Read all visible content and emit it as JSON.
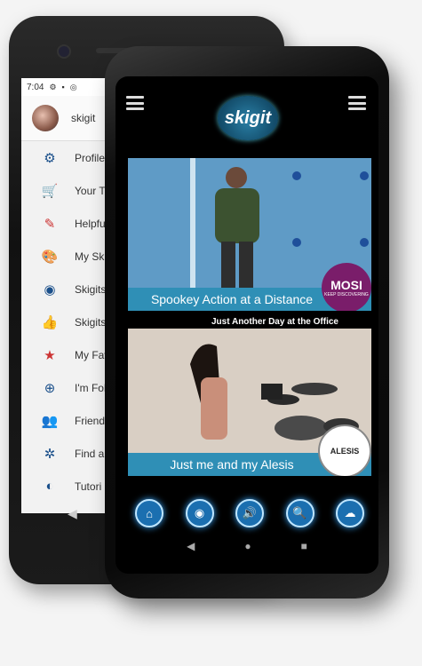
{
  "back_phone": {
    "status": {
      "time": "7:04"
    },
    "profile": {
      "name": "skigit"
    },
    "menu": [
      {
        "label": "Profile",
        "icon": "gear-icon",
        "glyph": "⚙",
        "color": "#1a4f8a"
      },
      {
        "label": "Your Tl",
        "icon": "cart-icon",
        "glyph": "🛒",
        "color": "#c33"
      },
      {
        "label": "Helpfu",
        "icon": "help-icon",
        "glyph": "✎",
        "color": "#c33"
      },
      {
        "label": "My Ski",
        "icon": "palette-icon",
        "glyph": "🎨",
        "color": "#1a4f8a"
      },
      {
        "label": "Skigits",
        "icon": "skigit-icon",
        "glyph": "◉",
        "color": "#1a4f8a"
      },
      {
        "label": "Skigits",
        "icon": "thumbs-up-icon",
        "glyph": "👍",
        "color": "#c33"
      },
      {
        "label": "My Fav",
        "icon": "star-icon",
        "glyph": "★",
        "color": "#c33"
      },
      {
        "label": "I'm Fol",
        "icon": "follow-icon",
        "glyph": "⊕",
        "color": "#1a4f8a"
      },
      {
        "label": "Friends",
        "icon": "friends-icon",
        "glyph": "👥",
        "color": "#1a4f8a"
      },
      {
        "label": "Find a",
        "icon": "bug-icon",
        "glyph": "✲",
        "color": "#1a4f8a"
      },
      {
        "label": "Tutori",
        "icon": "tutorial-icon",
        "glyph": "◐",
        "color": "#1a4f8a"
      }
    ]
  },
  "front_phone": {
    "logo": {
      "text": "skigit"
    },
    "videos": [
      {
        "caption": "Spookey Action at a Distance",
        "badge": "MOSI",
        "badge_sub": "KEEP DISCOVERING"
      },
      {
        "caption": "Just me and my Alesis",
        "badge": "ALESIS"
      }
    ],
    "overlay_title": "Just Another Day at the Office",
    "bottom_buttons": [
      {
        "icon": "home-icon",
        "glyph": "⌂"
      },
      {
        "icon": "globe-icon",
        "glyph": "◉"
      },
      {
        "icon": "speaker-icon",
        "glyph": "🔊"
      },
      {
        "icon": "search-icon",
        "glyph": "🔍"
      },
      {
        "icon": "cloud-upload-icon",
        "glyph": "☁"
      }
    ],
    "nav": {
      "back": "◀",
      "home": "●",
      "recent": "■"
    }
  }
}
